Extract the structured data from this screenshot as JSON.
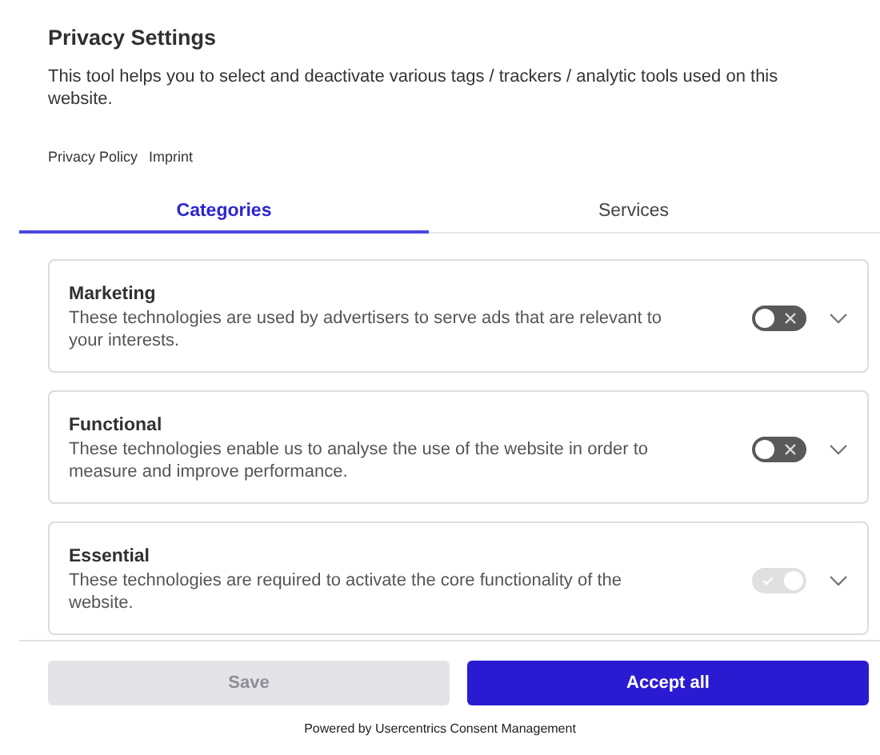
{
  "title": "Privacy Settings",
  "description": "This tool helps you to select and deactivate various tags / trackers / analytic tools used on this website.",
  "links": [
    "Privacy Policy",
    "Imprint"
  ],
  "tabs": [
    {
      "label": "Categories",
      "selected": true
    },
    {
      "label": "Services",
      "selected": false
    }
  ],
  "categories": [
    {
      "name": "Marketing",
      "description": "These technologies are used by advertisers to serve ads that are relevant to your interests.",
      "checked": false,
      "disabled": false
    },
    {
      "name": "Functional",
      "description": "These technologies enable us to analyse the use of the website in order to measure and improve performance.",
      "checked": false,
      "disabled": false
    },
    {
      "name": "Essential",
      "description": "These technologies are required to activate the core functionality of the website.",
      "checked": true,
      "disabled": true
    }
  ],
  "buttons": [
    {
      "label": "Save",
      "kind": "secondary",
      "disabled": true
    },
    {
      "label": "Accept all",
      "kind": "primary",
      "disabled": false
    }
  ],
  "footer": "Powered by Usercentrics Consent Management"
}
